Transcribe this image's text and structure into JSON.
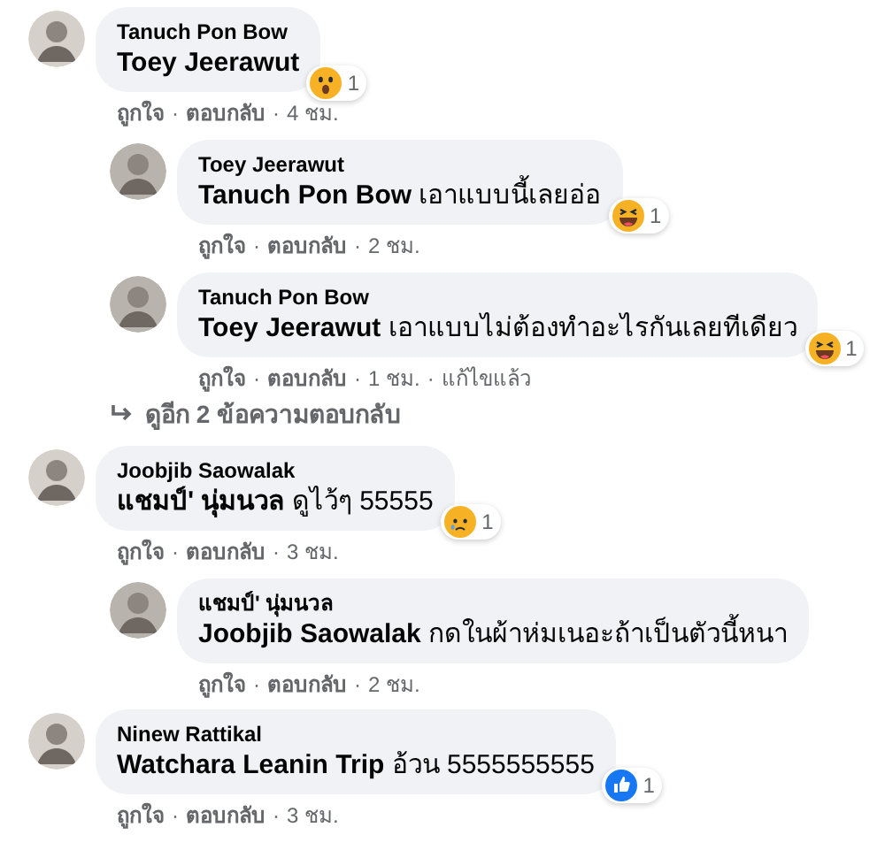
{
  "separator": "·",
  "comments": [
    {
      "author": "Tanuch Pon Bow",
      "message": "**Toey Jeerawut**",
      "reaction": {
        "kind": "wow",
        "count": "1"
      },
      "like": "ถูกใจ",
      "reply": "ตอบกลับ",
      "time": "4 ชม.",
      "more_replies": "ดูอีก 2 ข้อความตอบกลับ",
      "replies": [
        {
          "author": "Toey Jeerawut",
          "message": "**Tanuch Pon Bow** เอาแบบนี้เลยอ่อ",
          "reaction": {
            "kind": "haha",
            "count": "1"
          },
          "like": "ถูกใจ",
          "reply": "ตอบกลับ",
          "time": "2 ชม."
        },
        {
          "author": "Tanuch Pon Bow",
          "message": "**Toey Jeerawut** เอาแบบไม่ต้องทำอะไรกันเลยทีเดียว",
          "reaction": {
            "kind": "haha",
            "count": "1"
          },
          "like": "ถูกใจ",
          "reply": "ตอบกลับ",
          "time": "1 ชม.",
          "edited": "แก้ไขแล้ว"
        }
      ]
    },
    {
      "author": "Joobjib Saowalak",
      "message": "**แชมป์' นุ่มนวล** ดูไว้ๆ 55555",
      "reaction": {
        "kind": "sad",
        "count": "1"
      },
      "like": "ถูกใจ",
      "reply": "ตอบกลับ",
      "time": "3 ชม.",
      "replies": [
        {
          "author": "แชมป์' นุ่มนวล",
          "message": "**Joobjib Saowalak** กดในผ้าห่มเนอะถ้าเป็นตัวนี้หนา",
          "like": "ถูกใจ",
          "reply": "ตอบกลับ",
          "time": "2 ชม."
        }
      ]
    },
    {
      "author": "Ninew Rattikal",
      "message": "**Watchara Leanin Trip** อ้วน 5555555555",
      "reaction": {
        "kind": "like",
        "count": "1"
      },
      "like": "ถูกใจ",
      "reply": "ตอบกลับ",
      "time": "3 ชม."
    }
  ]
}
